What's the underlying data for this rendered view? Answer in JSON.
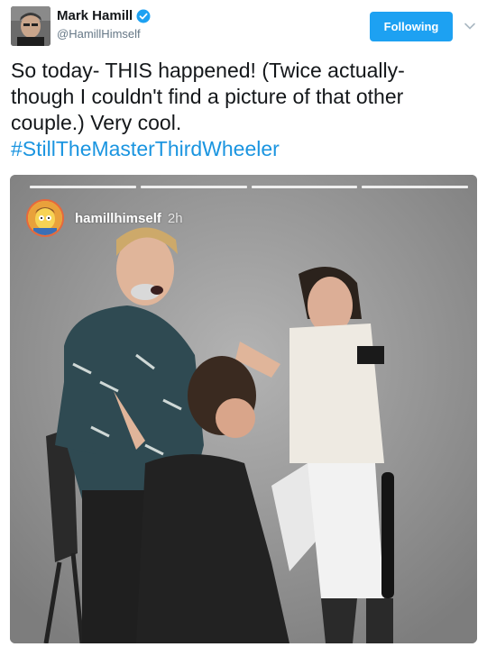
{
  "tweet": {
    "author": {
      "display_name": "Mark Hamill",
      "handle": "@HamillHimself",
      "avatar_icon": "profile-photo",
      "verified": true
    },
    "follow_button_label": "Following",
    "text_lines": [
      "So today- THIS happened! (Twice actually-",
      "though I couldn't find a picture of that other",
      "couple.) Very cool."
    ],
    "hashtag": "#StillTheMasterThirdWheeler",
    "media": {
      "story": {
        "username": "hamillhimself",
        "time": "2h",
        "progress_segments": 4
      }
    }
  },
  "colors": {
    "accent": "#1da1f2",
    "hashtag": "#1b95e0",
    "handle": "#657786"
  }
}
